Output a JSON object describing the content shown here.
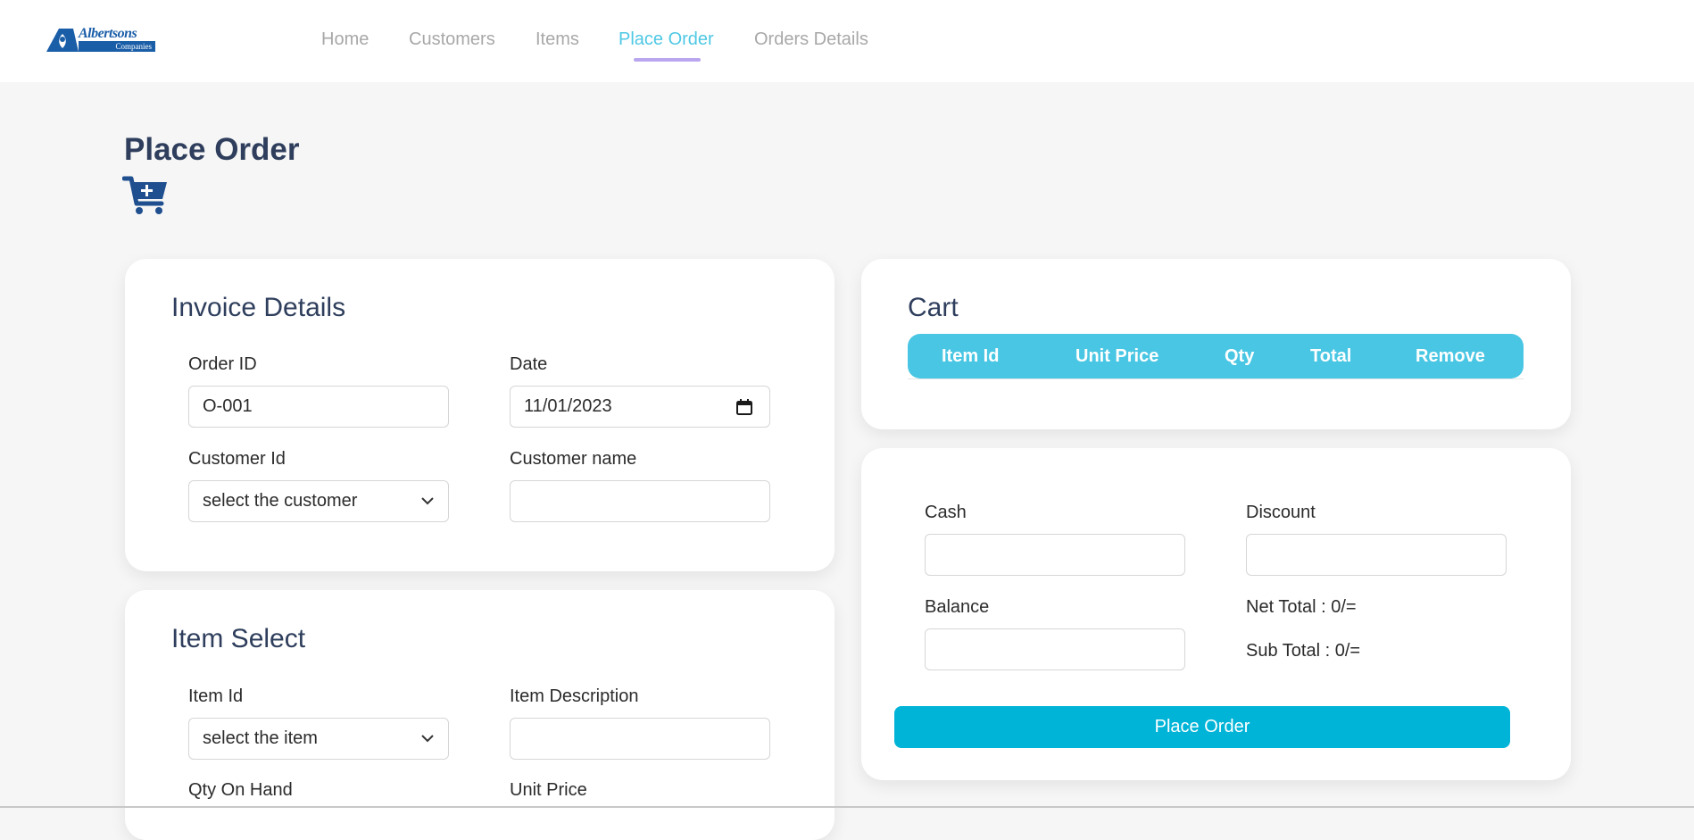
{
  "brand": {
    "name": "Albertsons",
    "sub": "Companies"
  },
  "nav": {
    "items": [
      "Home",
      "Customers",
      "Items",
      "Place Order",
      "Orders Details"
    ],
    "active": "Place Order"
  },
  "page": {
    "title": "Place Order",
    "icon": "cart-plus-icon"
  },
  "invoice": {
    "title": "Invoice Details",
    "order_id_label": "Order ID",
    "order_id_value": "O-001",
    "date_label": "Date",
    "date_value": "11/01/2023",
    "customer_id_label": "Customer Id",
    "customer_id_selected": "select the customer",
    "customer_name_label": "Customer name",
    "customer_name_value": ""
  },
  "item_select": {
    "title": "Item Select",
    "item_id_label": "Item Id",
    "item_id_selected": "select the item",
    "item_desc_label": "Item Description",
    "item_desc_value": "",
    "qty_on_hand_label": "Qty On Hand",
    "unit_price_label": "Unit Price"
  },
  "cart": {
    "title": "Cart",
    "columns": [
      "Item Id",
      "Unit Price",
      "Qty",
      "Total",
      "Remove"
    ],
    "rows": []
  },
  "payment": {
    "cash_label": "Cash",
    "cash_value": "",
    "discount_label": "Discount",
    "discount_value": "",
    "balance_label": "Balance",
    "balance_value": "",
    "net_total": "Net Total : 0/=",
    "sub_total": "Sub Total : 0/=",
    "place_order_label": "Place Order"
  },
  "colors": {
    "accent": "#4ec8e4",
    "nav_underline": "#b9a6ee",
    "title": "#2e3e5c",
    "button": "#00b4d8",
    "cart_header": "#48c6e3",
    "icon": "#1f4f8f"
  }
}
